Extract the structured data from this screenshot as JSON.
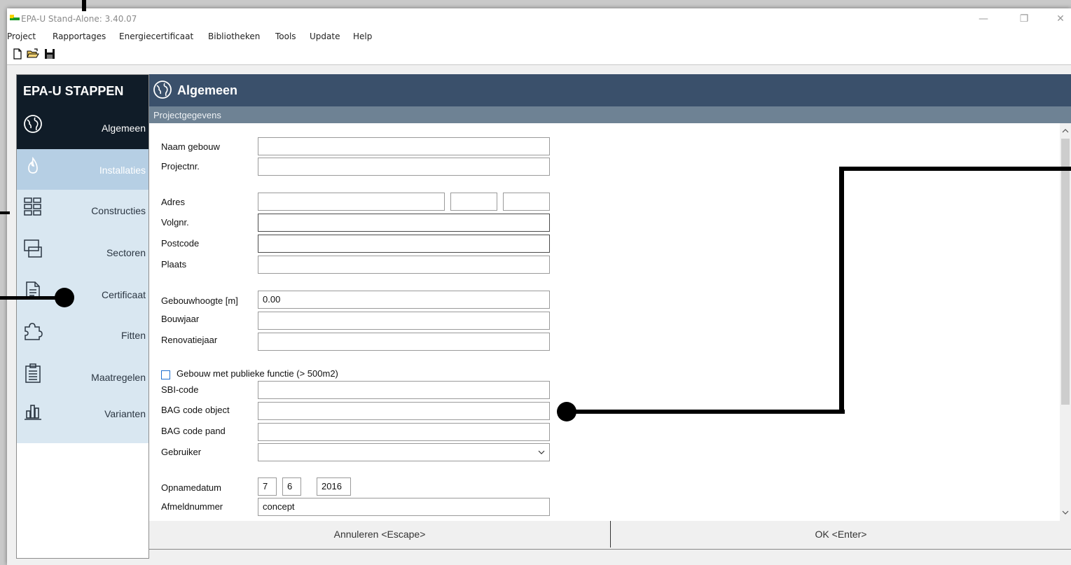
{
  "window": {
    "title": "EPA-U Stand-Alone: 3.40.07",
    "controls": [
      "—",
      "❐",
      "✕"
    ]
  },
  "menu": [
    "Project",
    "Rapportages",
    "Energiecertificaat",
    "Bibliotheken",
    "Tools",
    "Update",
    "Help"
  ],
  "toolbar": {
    "icons": [
      "new-file-icon",
      "open-folder-icon",
      "save-disk-icon"
    ]
  },
  "steps": {
    "header": "EPA-U STAPPEN",
    "items": [
      {
        "label": "Algemeen",
        "icon": "globe-icon",
        "state": "active"
      },
      {
        "label": "Installaties",
        "icon": "flame-icon",
        "state": "selected"
      },
      {
        "label": "Constructies",
        "icon": "wall-icon",
        "state": "normal"
      },
      {
        "label": "Sectoren",
        "icon": "sectors-icon",
        "state": "normal"
      },
      {
        "label": "Certificaat",
        "icon": "document-icon",
        "state": "normal"
      },
      {
        "label": "Fitten",
        "icon": "puzzle-icon",
        "state": "normal"
      },
      {
        "label": "Maatregelen",
        "icon": "clipboard-icon",
        "state": "normal"
      },
      {
        "label": "Varianten",
        "icon": "bar-chart-icon",
        "state": "normal"
      }
    ]
  },
  "main": {
    "title": "Algemeen",
    "section": "Projectgegevens"
  },
  "form": {
    "naam_gebouw": {
      "label": "Naam gebouw",
      "value": ""
    },
    "projectnr": {
      "label": "Projectnr.",
      "value": ""
    },
    "adres": {
      "label": "Adres",
      "street": "",
      "number": "",
      "addition": ""
    },
    "volgnr": {
      "label": "Volgnr.",
      "value": ""
    },
    "postcode": {
      "label": "Postcode",
      "value": ""
    },
    "plaats": {
      "label": "Plaats",
      "value": ""
    },
    "gebouwhoogte": {
      "label": "Gebouwhoogte [m]",
      "value": "0.00"
    },
    "bouwjaar": {
      "label": "Bouwjaar",
      "value": ""
    },
    "renovatiejaar": {
      "label": "Renovatiejaar",
      "value": ""
    },
    "publieke_functie": {
      "label": "Gebouw met publieke functie (> 500m2)",
      "checked": false
    },
    "sbi_code": {
      "label": "SBI-code",
      "value": ""
    },
    "bag_object": {
      "label": "BAG code object",
      "value": ""
    },
    "bag_pand": {
      "label": "BAG code pand",
      "value": ""
    },
    "gebruiker": {
      "label": "Gebruiker",
      "value": ""
    },
    "opnamedatum": {
      "label": "Opnamedatum",
      "day": "7",
      "month": "6",
      "year": "2016"
    },
    "afmeldnummer": {
      "label": "Afmeldnummer",
      "value": "concept"
    }
  },
  "buttons": {
    "cancel": "Annuleren <Escape>",
    "ok": "OK <Enter>"
  },
  "colors": {
    "steps_header": "#101c28",
    "main_header": "#3a506b",
    "section_bar": "#6e8294",
    "step_bg": "#d9e7f1",
    "step_selected": "#b6cfe4"
  }
}
